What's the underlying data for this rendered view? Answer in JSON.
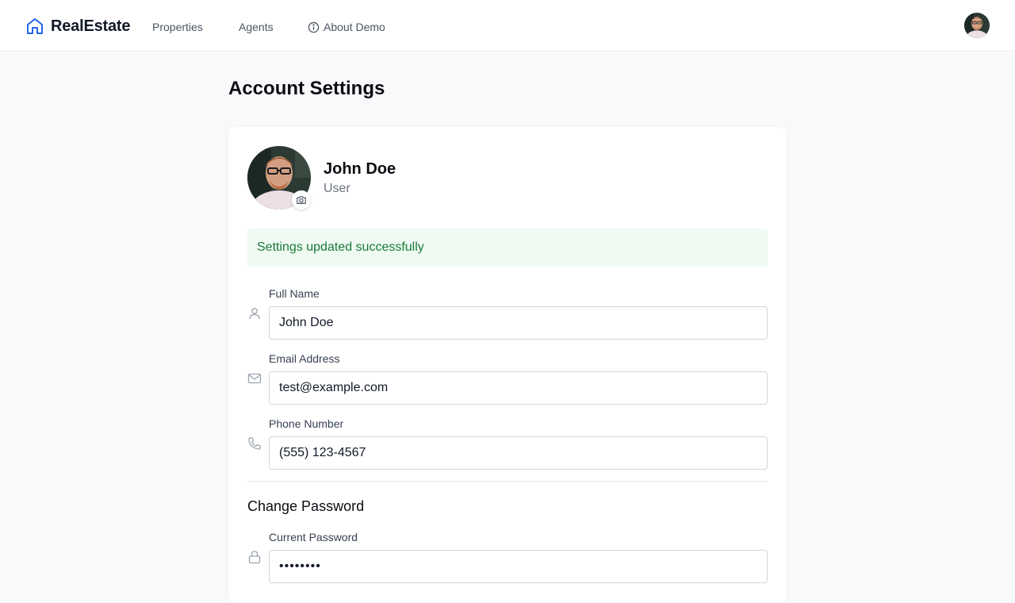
{
  "nav": {
    "brand": "RealEstate",
    "links": [
      "Properties",
      "Agents",
      "About Demo"
    ]
  },
  "page": {
    "title": "Account Settings"
  },
  "profile": {
    "name": "John Doe",
    "role": "User"
  },
  "alert": {
    "message": "Settings updated successfully"
  },
  "form": {
    "full_name": {
      "label": "Full Name",
      "value": "John Doe"
    },
    "email": {
      "label": "Email Address",
      "value": "test@example.com"
    },
    "phone": {
      "label": "Phone Number",
      "value": "(555) 123-4567"
    },
    "password_section_title": "Change Password",
    "current_password": {
      "label": "Current Password",
      "value": "••••••••"
    }
  },
  "icons": {
    "brand": "home-icon",
    "about": "info-icon",
    "camera": "camera-icon",
    "full_name": "user-icon",
    "email": "mail-icon",
    "phone": "phone-icon",
    "password": "lock-icon"
  },
  "colors": {
    "brand_accent": "#2563eb",
    "success_bg": "#effaf2",
    "success_text": "#1a7a3a"
  }
}
